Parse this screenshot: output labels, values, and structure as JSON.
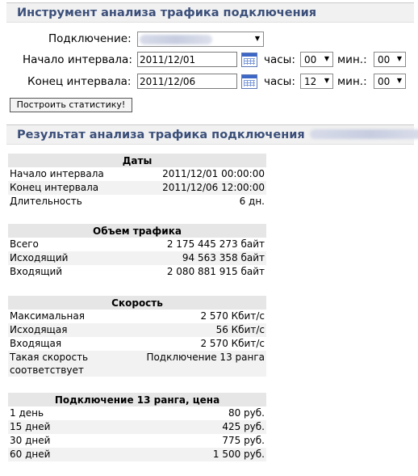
{
  "tool": {
    "title": "Инструмент анализа трафика подключения",
    "connection_label": "Подключение:",
    "start_label": "Начало интервала:",
    "end_label": "Конец интервала:",
    "hours_label": "часы:",
    "minutes_label": "мин.:",
    "start_date": "2011/12/01",
    "start_hours": "00",
    "start_minutes": "00",
    "end_date": "2011/12/06",
    "end_hours": "12",
    "end_minutes": "00",
    "build_button": "Построить статистику!"
  },
  "results": {
    "title": "Результат анализа трафика подключения",
    "dates": {
      "header": "Даты",
      "rows": [
        {
          "label": "Начало интервала",
          "value": "2011/12/01 00:00:00"
        },
        {
          "label": "Конец интервала",
          "value": "2011/12/06 12:00:00"
        },
        {
          "label": "Длительность",
          "value": "6 дн."
        }
      ]
    },
    "volume": {
      "header": "Объем трафика",
      "rows": [
        {
          "label": "Всего",
          "value": "2 175 445 273 байт"
        },
        {
          "label": "Исходящий",
          "value": "94 563 358 байт"
        },
        {
          "label": "Входящий",
          "value": "2 080 881 915 байт"
        }
      ]
    },
    "speed": {
      "header": "Скорость",
      "rows": [
        {
          "label": "Максимальная",
          "value": "2 570 Кбит/с"
        },
        {
          "label": "Исходящая",
          "value": "56 Кбит/с"
        },
        {
          "label": "Входящая",
          "value": "2 570 Кбит/с"
        },
        {
          "label": "Такая скорость соответствует",
          "value": "Подключение 13 ранга"
        }
      ]
    },
    "price": {
      "header": "Подключение 13 ранга, цена",
      "rows": [
        {
          "label": "1 день",
          "value": "80 руб."
        },
        {
          "label": "15 дней",
          "value": "425 руб."
        },
        {
          "label": "30 дней",
          "value": "775 руб."
        },
        {
          "label": "60 дней",
          "value": "1 500 руб."
        }
      ]
    }
  }
}
